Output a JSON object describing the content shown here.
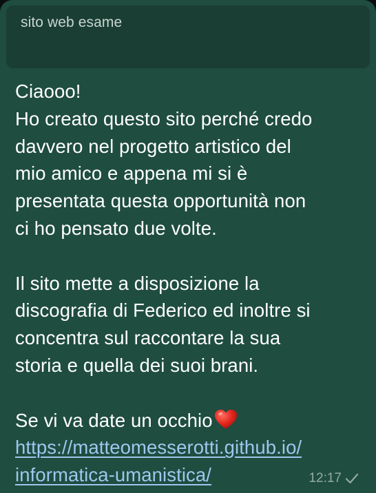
{
  "message": {
    "quoted_text": "sito web esame",
    "lines": [
      "Ciaooo!",
      "Ho creato questo sito perché credo",
      "davvero nel progetto artistico del",
      "mio amico e appena mi si è",
      "presentata questa opportunità non",
      "ci ho pensato due volte.",
      "Il sito mette a disposizione la",
      "discografia di Federico ed inoltre si",
      "concentra sul raccontare la sua",
      "storia e quella dei suoi brani.",
      "Se vi va date un occhio"
    ],
    "link_line_1": "https://matteomesserotti.github.io/",
    "link_line_2": "informatica-umanistica/",
    "time": "12:17",
    "status_icon": "single-check-icon",
    "emoji": "red-heart-icon"
  },
  "colors": {
    "bubble": "#1f4d40",
    "quote_box": "#1a3e33",
    "link": "#9fc7ee",
    "text": "#ffffff"
  }
}
